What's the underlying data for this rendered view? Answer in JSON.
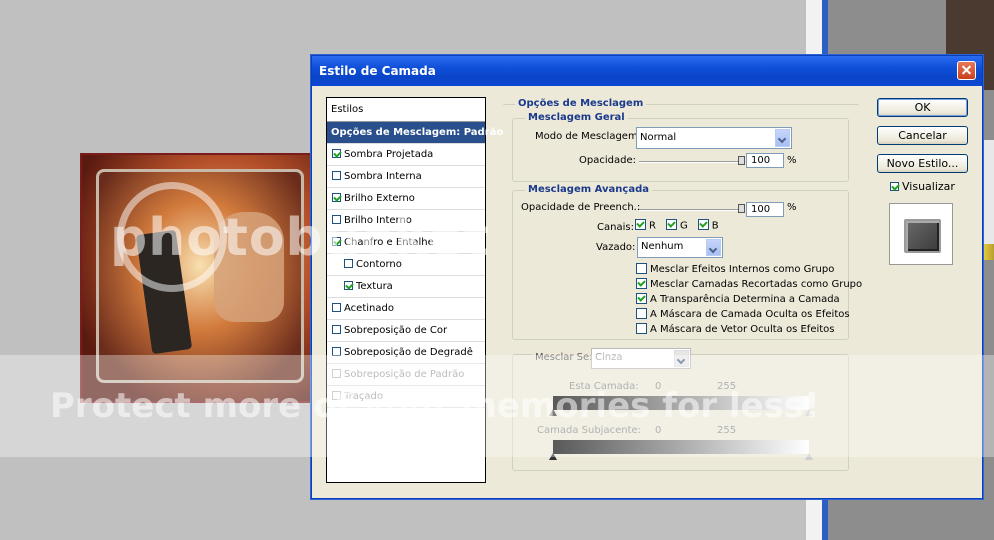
{
  "dialog": {
    "title": "Estilo de Camada"
  },
  "styles_panel": {
    "header": "Estilos",
    "items": [
      {
        "label": "Opções de Mesclagem: Padrão",
        "checkbox": false,
        "checked": false,
        "selected": true
      },
      {
        "label": "Sombra Projetada",
        "checkbox": true,
        "checked": true
      },
      {
        "label": "Sombra Interna",
        "checkbox": true,
        "checked": false
      },
      {
        "label": "Brilho Externo",
        "checkbox": true,
        "checked": true
      },
      {
        "label": "Brilho Interno",
        "checkbox": true,
        "checked": false
      },
      {
        "label": "Chanfro e Entalhe",
        "checkbox": true,
        "checked": true
      },
      {
        "label": "Contorno",
        "checkbox": true,
        "checked": false,
        "indent": true
      },
      {
        "label": "Textura",
        "checkbox": true,
        "checked": true,
        "indent": true
      },
      {
        "label": "Acetinado",
        "checkbox": true,
        "checked": false
      },
      {
        "label": "Sobreposição de Cor",
        "checkbox": true,
        "checked": false
      },
      {
        "label": "Sobreposição de Degradê",
        "checkbox": true,
        "checked": false
      },
      {
        "label": "Sobreposição de Padrão",
        "checkbox": true,
        "checked": false,
        "disabled": true
      },
      {
        "label": "Traçado",
        "checkbox": true,
        "checked": false,
        "disabled": true
      }
    ]
  },
  "blending": {
    "section_title": "Opções de Mesclagem",
    "general": {
      "title": "Mesclagem Geral",
      "mode_label": "Modo de Mesclagem:",
      "mode_value": "Normal",
      "opacity_label": "Opacidade:",
      "opacity_value": "100",
      "opacity_unit": "%",
      "opacity_level": 100
    },
    "advanced": {
      "title": "Mesclagem Avançada",
      "fill_label": "Opacidade de Preench.:",
      "fill_value": "100",
      "fill_unit": "%",
      "fill_level": 100,
      "channels_label": "Canais:",
      "channels": [
        {
          "label": "R",
          "checked": true
        },
        {
          "label": "G",
          "checked": true
        },
        {
          "label": "B",
          "checked": true
        }
      ],
      "knockout_label": "Vazado:",
      "knockout_value": "Nenhum",
      "options": [
        {
          "label": "Mesclar Efeitos Internos como Grupo",
          "checked": false
        },
        {
          "label": "Mesclar Camadas Recortadas como Grupo",
          "checked": true
        },
        {
          "label": "A Transparência Determina a Camada",
          "checked": true
        },
        {
          "label": "A Máscara de Camada Oculta os Efeitos",
          "checked": false
        },
        {
          "label": "A Máscara de Vetor Oculta os Efeitos",
          "checked": false
        }
      ]
    },
    "blend_if": {
      "label": "Mesclar Se:",
      "value": "Cinza",
      "this_layer_label": "Esta Camada:",
      "this_layer_min": "0",
      "this_layer_max": "255",
      "underlying_label": "Camada Subjacente:",
      "underlying_min": "0",
      "underlying_max": "255"
    }
  },
  "buttons": {
    "ok": "OK",
    "cancel": "Cancelar",
    "new_style": "Novo Estilo...",
    "preview_label": "Visualizar",
    "preview_checked": true
  },
  "watermark": {
    "top": "photobucket",
    "bottom": "Protect more of your memories for less!"
  },
  "colors": {
    "title_bar": "#0a45c8",
    "selected_item": "#29508c",
    "group_title": "#1b3a8c",
    "check": "#21a121"
  }
}
